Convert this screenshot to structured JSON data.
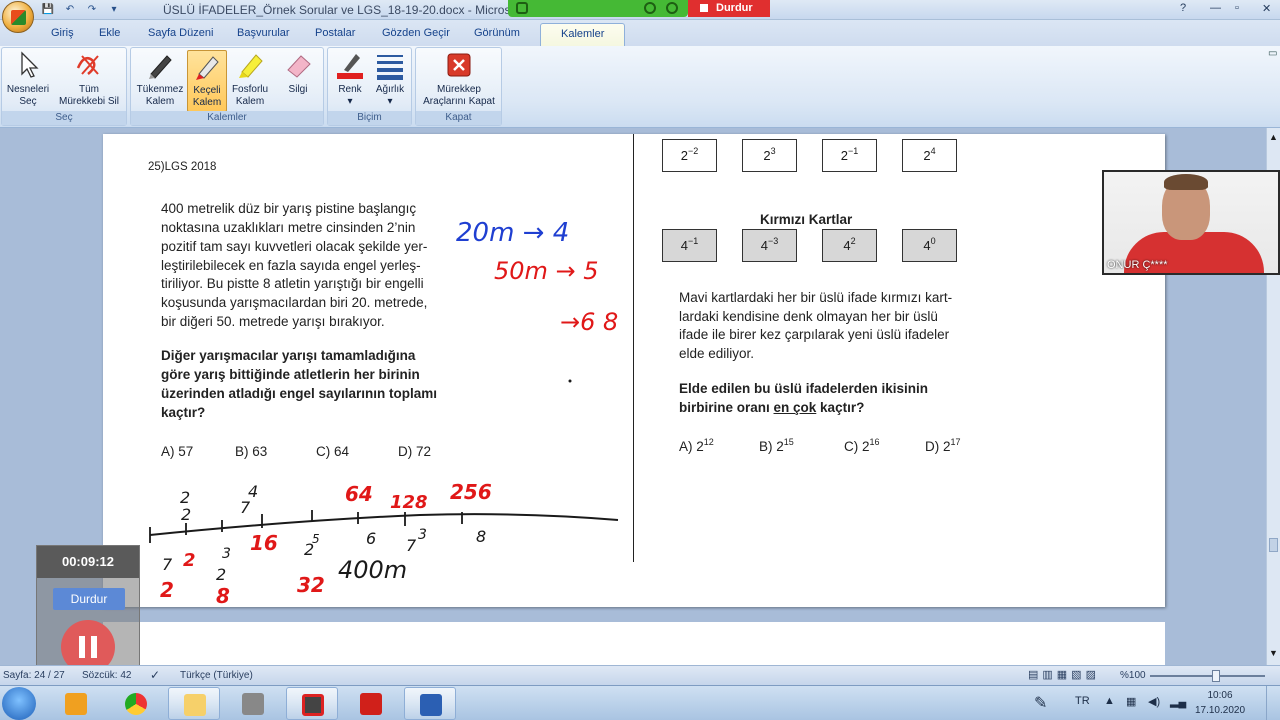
{
  "window": {
    "title": "ÜSLÜ İFADELER_Örnek Sorular ve LGS_18-19-20.docx - Microsoft W...",
    "recorder_stop": "Durdur"
  },
  "tabs": [
    "Giriş",
    "Ekle",
    "Sayfa Düzeni",
    "Başvurular",
    "Postalar",
    "Gözden Geçir",
    "Görünüm",
    "Kalemler"
  ],
  "ribbon": {
    "groups": {
      "sec": "Seç",
      "kalemler": "Kalemler",
      "bicim": "Biçim",
      "kapat": "Kapat"
    },
    "buttons": {
      "nesneleri_1": "Nesneleri",
      "nesneleri_2": "Seç",
      "tum_1": "Tüm",
      "tum_2": "Mürekkebi Sil",
      "tukenmez_1": "Tükenmez",
      "tukenmez_2": "Kalem",
      "keceli_1": "Keçeli",
      "keceli_2": "Kalem",
      "fosforlu_1": "Fosforlu",
      "fosforlu_2": "Kalem",
      "silgi": "Silgi",
      "renk": "Renk",
      "agirlik": "Ağırlık",
      "murekkep_1": "Mürekkep",
      "murekkep_2": "Araçlarını Kapat"
    }
  },
  "document": {
    "q25_header": "25)LGS 2018",
    "q25_lines": [
      "400 metrelik düz bir yarış pistine başlangıç",
      "noktasına uzaklıkları metre cinsinden 2’nin",
      "pozitif tam sayı kuvvetleri olacak şekilde yer-",
      "leştirilebilecek en fazla sayıda engel yerleş-",
      "tiriliyor. Bu pistte 8 atletin yarıştığı bir engelli",
      "koşusunda yarışmacılardan biri 20. metrede,",
      "bir diğeri 50. metrede yarışı bırakıyor."
    ],
    "q25_bold_lines": [
      "Diğer yarışmacılar yarışı tamamladığına",
      "göre yarış bittiğinde atletlerin her birinin",
      "üzerinden atladığı engel sayılarının toplamı",
      "kaçtır?"
    ],
    "q25_options": [
      "A) 57",
      "B) 63",
      "C) 64",
      "D) 72"
    ],
    "blue_cards": [
      {
        "base": "2",
        "exp": "−2"
      },
      {
        "base": "2",
        "exp": "3"
      },
      {
        "base": "2",
        "exp": "−1"
      },
      {
        "base": "2",
        "exp": "4"
      }
    ],
    "red_title": "Kırmızı Kartlar",
    "red_cards": [
      {
        "base": "4",
        "exp": "−1"
      },
      {
        "base": "4",
        "exp": "−3"
      },
      {
        "base": "4",
        "exp": "2"
      },
      {
        "base": "4",
        "exp": "0"
      }
    ],
    "q26_lines": [
      "Mavi kartlardaki her bir üslü ifade kırmızı kart-",
      "lardaki kendisine denk olmayan her bir üslü",
      "ifade ile birer kez çarpılarak yeni üslü ifadeler",
      "elde ediliyor."
    ],
    "q26_bold_1": "Elde edilen bu üslü ifadelerden ikisinin",
    "q26_bold_2a": "birbirine oranı ",
    "q26_bold_2b": "en çok",
    "q26_bold_2c": " kaçtır?",
    "q26_options": [
      {
        "label": "A) 2",
        "exp": "12"
      },
      {
        "label": "B) 2",
        "exp": "15"
      },
      {
        "label": "C) 2",
        "exp": "16"
      },
      {
        "label": "D) 2",
        "exp": "17"
      }
    ]
  },
  "ink": {
    "blue": [
      "20m → 4",
      "50m → 5",
      "→6 8",
      "400m"
    ],
    "red": [
      "64",
      "128",
      "256",
      "16",
      "32",
      "2",
      "8",
      "2"
    ],
    "black_ticks": [
      "2",
      "2",
      "4",
      "7",
      "7",
      "2",
      "3",
      "2",
      "5",
      "6",
      "7",
      "3",
      "8"
    ],
    "colors": {
      "blue": "#1f3fd1",
      "red": "#e01818",
      "black": "#1a1a1a"
    }
  },
  "webcam": {
    "name": "ONUR Ç****"
  },
  "recorder": {
    "time": "00:09:12",
    "stop": "Durdur"
  },
  "status": {
    "page": "Sayfa: 24 / 27",
    "words": "Sözcük: 42",
    "language": "Türkçe (Türkiye)",
    "zoom": "%100"
  },
  "taskbar": {
    "lang": "TR",
    "time": "10:06",
    "date": "17.10.2020"
  }
}
